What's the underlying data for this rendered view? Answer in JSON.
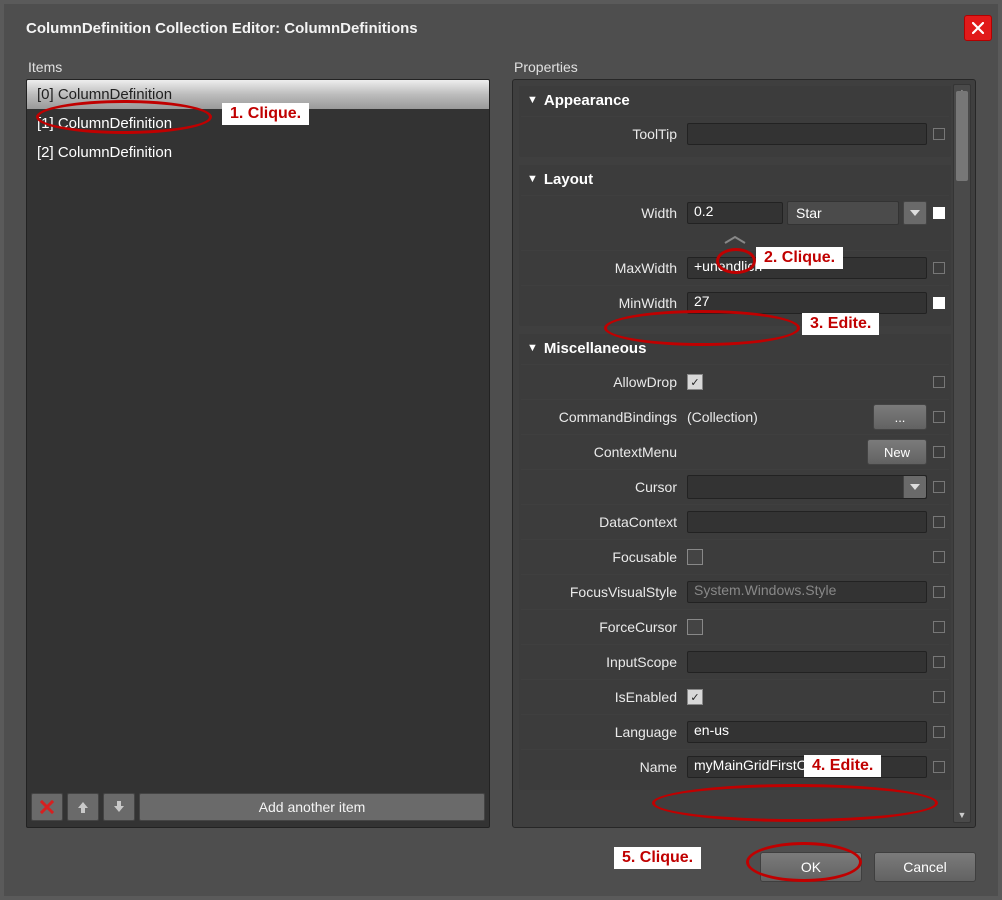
{
  "title": "ColumnDefinition Collection Editor: ColumnDefinitions",
  "labels": {
    "items": "Items",
    "properties": "Properties",
    "add": "Add another item",
    "ok": "OK",
    "cancel": "Cancel"
  },
  "items": [
    "[0] ColumnDefinition",
    "[1] ColumnDefinition",
    "[2] ColumnDefinition"
  ],
  "cats": {
    "appearance": {
      "title": "Appearance",
      "tooltip_label": "ToolTip",
      "tooltip_value": ""
    },
    "layout": {
      "title": "Layout",
      "width_label": "Width",
      "width_value": "0.2",
      "width_unit": "Star",
      "maxwidth_label": "MaxWidth",
      "maxwidth_value": "+unendlich",
      "minwidth_label": "MinWidth",
      "minwidth_value": "27"
    },
    "misc": {
      "title": "Miscellaneous",
      "allowdrop_label": "AllowDrop",
      "allowdrop": true,
      "cmdbind_label": "CommandBindings",
      "cmdbind_value": "(Collection)",
      "cmdbind_btn": "...",
      "ctxmenu_label": "ContextMenu",
      "ctxmenu_btn": "New",
      "cursor_label": "Cursor",
      "cursor_value": "",
      "datactx_label": "DataContext",
      "datactx_value": "",
      "focusable_label": "Focusable",
      "focusable": false,
      "fvs_label": "FocusVisualStyle",
      "fvs_value": "System.Windows.Style",
      "forcecursor_label": "ForceCursor",
      "forcecursor": false,
      "inscope_label": "InputScope",
      "inscope_value": "",
      "isen_label": "IsEnabled",
      "isen": true,
      "lang_label": "Language",
      "lang_value": "en-us",
      "name_label": "Name",
      "name_value": "myMainGridFirstColumn"
    }
  },
  "annotations": {
    "a1": "1. Clique.",
    "a2": "2. Clique.",
    "a3": "3. Edite.",
    "a4": "4. Edite.",
    "a5": "5. Clique."
  }
}
